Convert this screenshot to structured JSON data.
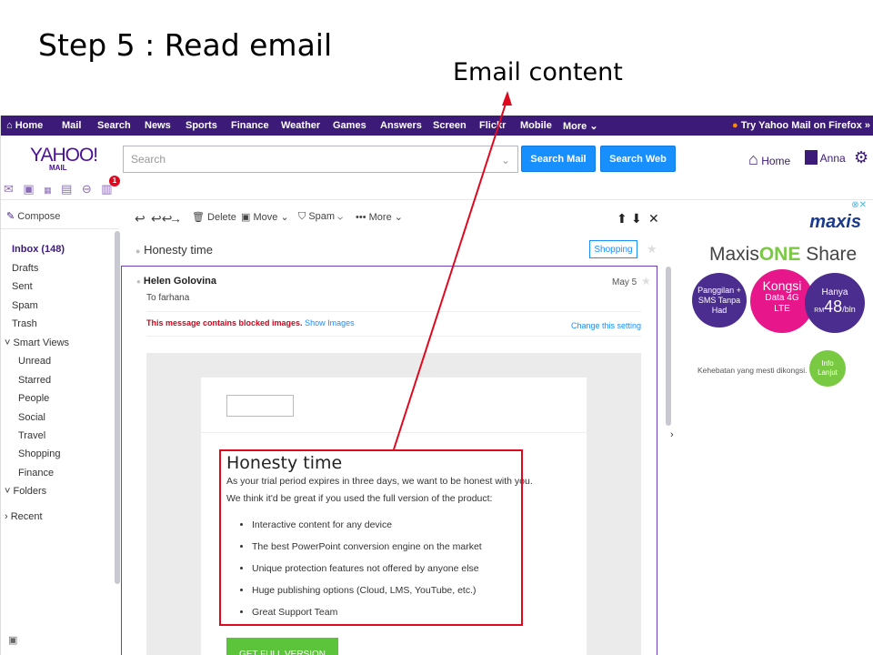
{
  "slide": {
    "title": "Step 5 : Read email",
    "callout_label": "Email content"
  },
  "topnav": {
    "items": [
      "Home",
      "Mail",
      "Search",
      "News",
      "Sports",
      "Finance",
      "Weather",
      "Games",
      "Answers",
      "Screen",
      "Flickr",
      "Mobile",
      "More"
    ],
    "firefox_promo": "Try Yahoo Mail on Firefox »"
  },
  "header": {
    "logo": "YAHOO!",
    "logo_sub": "MAIL",
    "search_placeholder": "Search",
    "search_mail_label": "Search Mail",
    "search_web_label": "Search Web",
    "home_label": "Home",
    "user_name": "Anna",
    "notification_count": "1"
  },
  "sidebar": {
    "compose_label": "Compose",
    "inbox_label": "Inbox (148)",
    "folders": [
      "Drafts",
      "Sent",
      "Spam",
      "Trash"
    ],
    "smart_views_label": "Smart Views",
    "smart_views": [
      "Unread",
      "Starred",
      "People",
      "Social",
      "Travel",
      "Shopping",
      "Finance"
    ],
    "folders_label": "Folders",
    "recent_label": "Recent"
  },
  "toolbar": {
    "delete_label": "Delete",
    "move_label": "Move",
    "spam_label": "Spam",
    "more_label": "More"
  },
  "email": {
    "subject": "Honesty time",
    "tag": "Shopping",
    "sender": "Helen Golovina",
    "to_label": "To",
    "to": "farhana",
    "date": "May 5",
    "blocked_notice": "This message contains blocked images.",
    "show_images": "Show Images",
    "change_setting": "Change this setting",
    "body_title": "Honesty time",
    "body_line1": "As your trial period expires in three days, we want to be honest with you.",
    "body_line2": "We think it'd be great if you used the full version of the product:",
    "bullets": [
      "Interactive content for any device",
      "The best PowerPoint conversion engine on the market",
      "Unique protection features not offered by anyone else",
      "Huge publishing options (Cloud, LMS, YouTube, etc.)",
      "Great Support Team"
    ],
    "cta_label": "GET FULL VERSION"
  },
  "ad": {
    "brand": "maxis",
    "headline_a": "Maxis",
    "headline_b": "ONE",
    "headline_c": " Share",
    "circle1": "Panggilan + SMS Tanpa Had",
    "circle2_a": "Kongsi",
    "circle2_b": "Data 4G LTE",
    "circle3_a": "Hanya",
    "circle3_currency": "RM",
    "circle3_price": "48",
    "circle3_unit": "/bln",
    "tagline": "Kehebatan yang mesti dikongsi.",
    "info_btn": "Info Lanjut"
  },
  "colors": {
    "yahoo_purple": "#3b1a78",
    "button_blue": "#188fff",
    "callout_red": "#e0081e",
    "cta_green": "#5cc43a",
    "maxis_green": "#7ac943",
    "maxis_pink": "#e8168b",
    "maxis_purple": "#4b2c8f"
  }
}
